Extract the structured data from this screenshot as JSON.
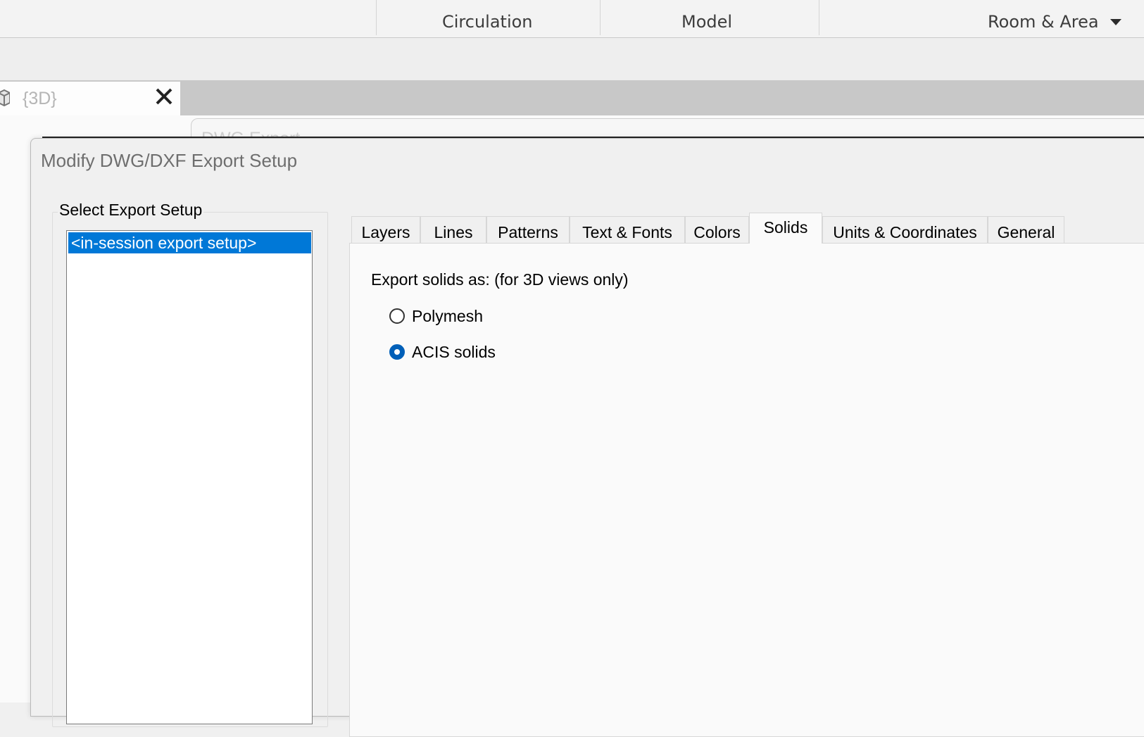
{
  "ribbon": {
    "panels": [
      {
        "label": "Circulation"
      },
      {
        "label": "Model"
      },
      {
        "label": "Room & Area"
      }
    ]
  },
  "view_tab": {
    "title": "{3D}"
  },
  "behind_dialog": {
    "title": "DWG Export"
  },
  "dialog": {
    "title": "Modify DWG/DXF Export Setup",
    "setup_group_label": "Select Export Setup",
    "setups": [
      "<in-session export setup>"
    ],
    "tabs": [
      "Layers",
      "Lines",
      "Patterns",
      "Text & Fonts",
      "Colors",
      "Solids",
      "Units & Coordinates",
      "General"
    ],
    "active_tab": "Solids",
    "solids": {
      "label": "Export solids as: (for 3D views only)",
      "options": [
        "Polymesh",
        "ACIS solids"
      ],
      "selected": "ACIS solids"
    }
  },
  "colors": {
    "selection": "#0078d7",
    "radio_checked": "#005fb8"
  }
}
